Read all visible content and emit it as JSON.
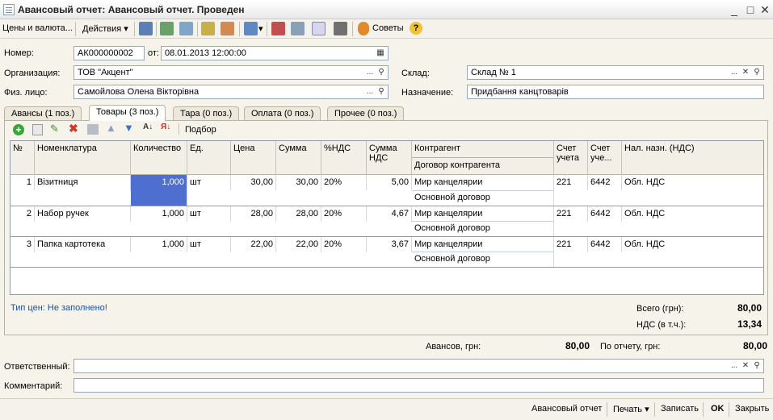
{
  "window": {
    "title": "Авансовый отчет: Авансовый отчет. Проведен",
    "controls": [
      "_",
      "□",
      "✕"
    ]
  },
  "toolbar": {
    "prices_label": "Цены и валюта...",
    "actions_label": "Действия",
    "tips_label": "Советы",
    "help_label": "?"
  },
  "header": {
    "number_label": "Номер:",
    "number_value": "АК000000002",
    "date_label": "от:",
    "date_value": "08.01.2013 12:00:00",
    "org_label": "Организация:",
    "org_value": "ТОВ \"Акцент\"",
    "warehouse_label": "Склад:",
    "warehouse_value": "Склад № 1",
    "person_label": "Физ. лицо:",
    "person_value": "Самойлова Олена Вікторівна",
    "purpose_label": "Назначение:",
    "purpose_value": "Придбання канцтоварів",
    "dots": "...",
    "clear": "✕"
  },
  "tabs": [
    {
      "label": "Авансы (1 поз.)"
    },
    {
      "label": "Товары (3 поз.)"
    },
    {
      "label": "Тара (0 поз.)"
    },
    {
      "label": "Оплата (0 поз.)"
    },
    {
      "label": "Прочее (0 поз.)"
    }
  ],
  "table_toolbar": {
    "pick_label": "Подбор"
  },
  "table": {
    "columns": {
      "num": "№",
      "item": "Номенклатура",
      "qty": "Количество",
      "unit": "Ед.",
      "price": "Цена",
      "sum": "Сумма",
      "vat_rate": "%НДС",
      "vat_sum": "Сумма НДС",
      "counterparty": "Контрагент",
      "contract": "Договор контрагента",
      "account": "Счет учета",
      "account2": "Счет уче...",
      "tax_purpose": "Нал. назн. (НДС)"
    },
    "rows": [
      {
        "num": "1",
        "item": "Візитниця",
        "qty": "1,000",
        "unit": "шт",
        "price": "30,00",
        "sum": "30,00",
        "vat_rate": "20%",
        "vat_sum": "5,00",
        "counterparty": "Мир канцелярии",
        "contract": "Основной договор",
        "account": "221",
        "account2": "6442",
        "tax_purpose": "Обл. НДС"
      },
      {
        "num": "2",
        "item": "Набор ручек",
        "qty": "1,000",
        "unit": "шт",
        "price": "28,00",
        "sum": "28,00",
        "vat_rate": "20%",
        "vat_sum": "4,67",
        "counterparty": "Мир канцелярии",
        "contract": "Основной договор",
        "account": "221",
        "account2": "6442",
        "tax_purpose": "Обл. НДС"
      },
      {
        "num": "3",
        "item": "Папка картотека",
        "qty": "1,000",
        "unit": "шт",
        "price": "22,00",
        "sum": "22,00",
        "vat_rate": "20%",
        "vat_sum": "3,67",
        "counterparty": "Мир канцелярии",
        "contract": "Основной договор",
        "account": "221",
        "account2": "6442",
        "tax_purpose": "Обл. НДС"
      }
    ]
  },
  "totals": {
    "price_type": "Тип цен: Не заполнено!",
    "total_label": "Всего (грн):",
    "total_value": "80,00",
    "vat_label": "НДС (в т.ч.):",
    "vat_value": "13,34",
    "advances_label": "Авансов, грн:",
    "advances_value": "80,00",
    "report_label": "По отчету, грн:",
    "report_value": "80,00"
  },
  "footer": {
    "responsible_label": "Ответственный:",
    "responsible_value": "",
    "comment_label": "Комментарий:",
    "comment_value": ""
  },
  "bottom": {
    "report_btn": "Авансовый отчет",
    "print_btn": "Печать",
    "save_btn": "Записать",
    "ok_btn": "OK",
    "close_btn": "Закрыть"
  },
  "colors": {
    "selected_cell": "#4f6fd0",
    "link": "#1c4fa0"
  }
}
